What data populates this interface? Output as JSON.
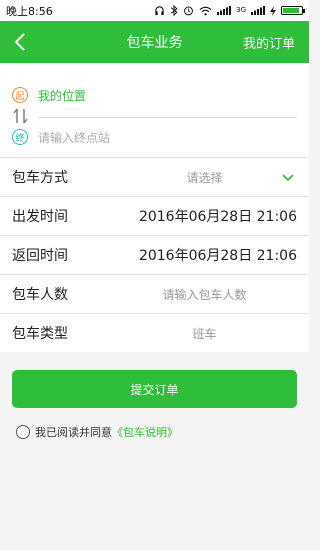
{
  "status_bar": {
    "time": "晚上8:56",
    "icons": [
      "headphones-icon",
      "bluetooth-icon",
      "alarm-icon",
      "wifi-icon",
      "signal-icon",
      "signal-icon",
      "charging-icon",
      "battery-icon"
    ],
    "network_label": "3G",
    "battery_level": 0.9
  },
  "header": {
    "back_icon": "chevron-left-icon",
    "title": "包车业务",
    "orders_label": "我的订单"
  },
  "route": {
    "start_tag": "起",
    "start_value": "我的位置",
    "end_tag": "终",
    "end_placeholder": "请输入终点站",
    "swap_icon": "swap-vertical-icon"
  },
  "form": {
    "rows": [
      {
        "label": "包车方式",
        "value": "请选择",
        "icon": "chevron-down-icon"
      },
      {
        "label": "出发时间",
        "value": "2016年06月28日 21:06"
      },
      {
        "label": "返回时间",
        "value": "2016年06月28日 21:06"
      },
      {
        "label": "包车人数",
        "value": "请输入包车人数"
      },
      {
        "label": "包车类型",
        "value": "班车"
      }
    ]
  },
  "submit_label": "提交订单",
  "agreement": {
    "prefix": "我已阅读并同意",
    "link": "《包车说明》"
  },
  "colors": {
    "accent": "#2ebe3a",
    "start_tag": "#f08a32",
    "end_tag": "#2db8c0",
    "placeholder": "#999999",
    "page_bg": "#f4f4f4"
  }
}
